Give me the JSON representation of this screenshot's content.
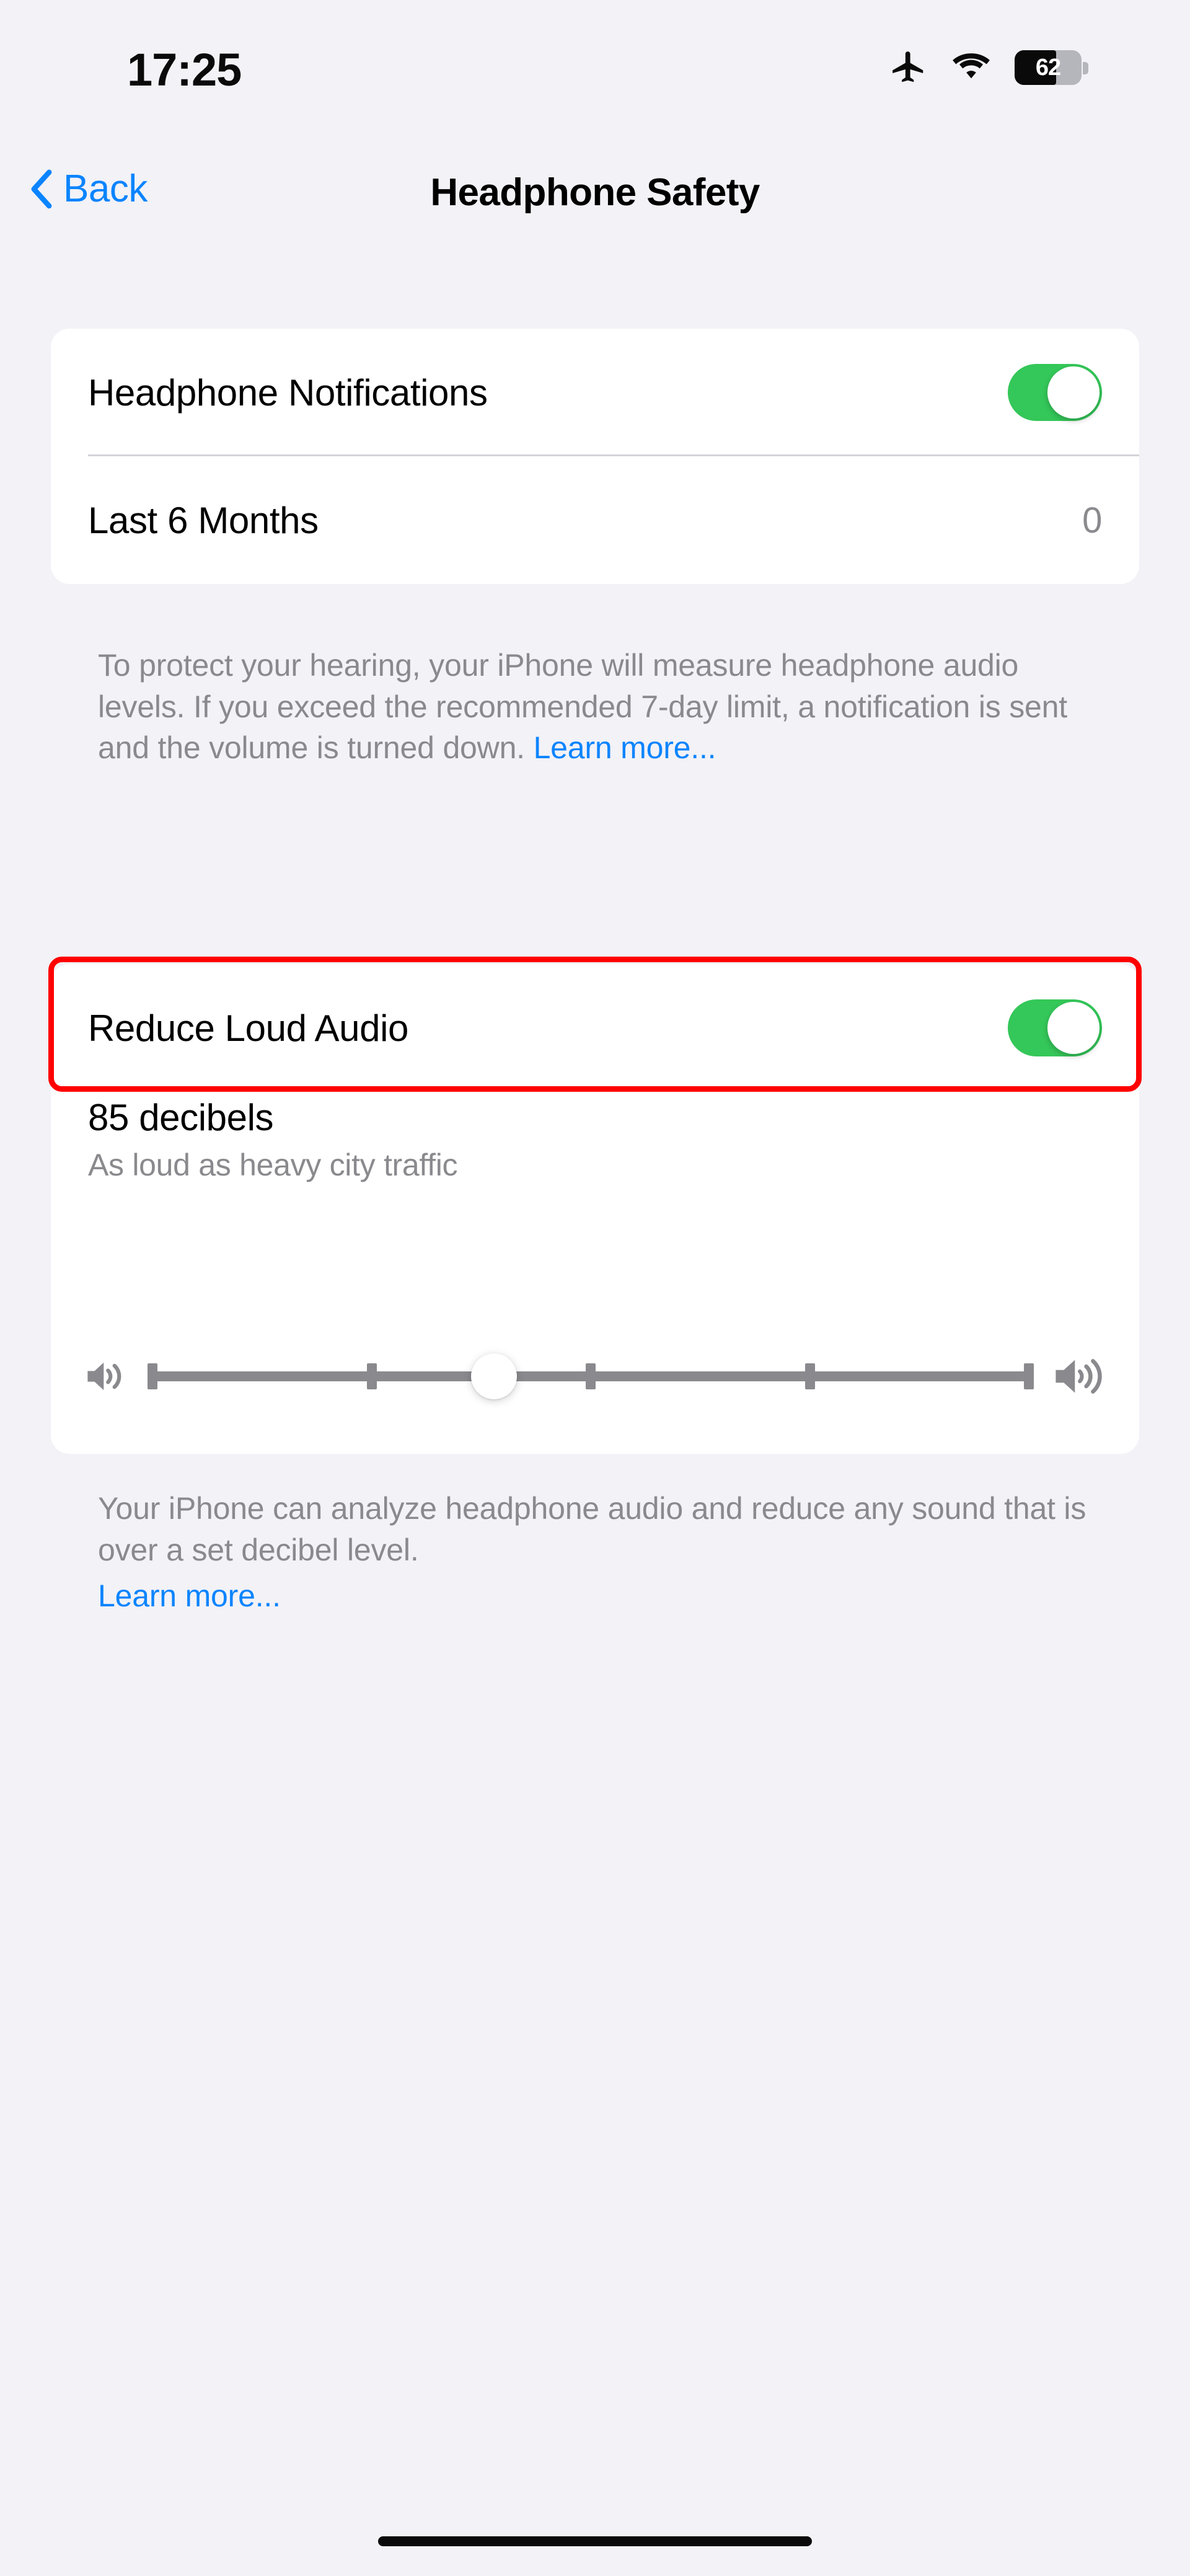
{
  "status_bar": {
    "time": "17:25",
    "airplane_icon": "airplane-mode-icon",
    "wifi_icon": "wifi-icon",
    "battery_percent": "62",
    "battery_level": 62
  },
  "nav": {
    "back_label": "Back",
    "back_icon": "chevron-left-icon",
    "title": "Headphone Safety"
  },
  "notifications_card": {
    "toggle_row": {
      "label": "Headphone Notifications",
      "toggle_state": "on"
    },
    "stat_row": {
      "label": "Last 6 Months",
      "value": "0"
    }
  },
  "notifications_footer": {
    "text": "To protect your hearing, your iPhone will measure headphone audio levels. If you exceed the recommended 7-day limit, a notification is sent and the volume is turned down. ",
    "link": "Learn more..."
  },
  "reduce_audio_card": {
    "toggle_row": {
      "label": "Reduce Loud Audio",
      "toggle_state": "on"
    },
    "decibel": {
      "title": "85 decibels",
      "subtitle": "As loud as heavy city traffic",
      "value": 85
    },
    "slider": {
      "left_icon": "speaker-low-icon",
      "right_icon": "speaker-high-icon",
      "position_percent": 39,
      "tick_percents": [
        0,
        25,
        50,
        75,
        100
      ]
    }
  },
  "reduce_audio_footer": {
    "text": "Your iPhone can analyze headphone audio and reduce any sound that is over a set decibel level.",
    "link": "Learn more..."
  },
  "annotation": {
    "highlight_color": "#FF0000",
    "target": "reduce-loud-audio-row"
  },
  "colors": {
    "background": "#F2F2F7",
    "card": "#FFFFFF",
    "accent_blue": "#0A84FF",
    "toggle_green": "#34C759",
    "secondary_text": "#8A8A8E"
  },
  "home_indicator": "home-indicator"
}
